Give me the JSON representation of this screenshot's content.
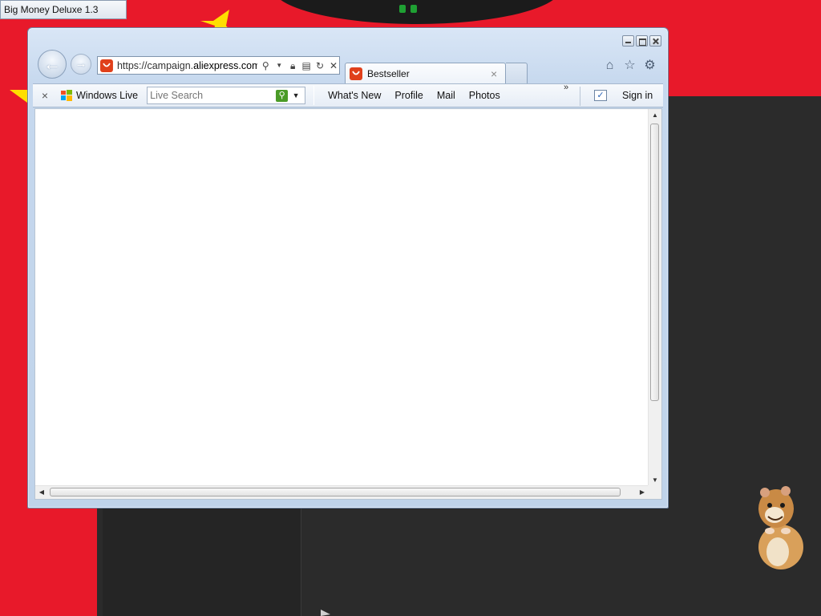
{
  "desktop": {
    "app_title": "Big Money Deluxe 1.3",
    "colors": {
      "flag_red": "#e8192a",
      "dark": "#2b2b2b",
      "star_yellow": "#ffde00"
    }
  },
  "browser": {
    "address_bar": {
      "url_prefix": "https://campaign.",
      "url_domain": "aliexpress.com",
      "icons": [
        "search-icon",
        "dropdown-icon",
        "lock-icon",
        "compat-icon",
        "refresh-icon",
        "stop-icon"
      ]
    },
    "tabs": [
      {
        "label": "Bestseller",
        "icon": "aliexpress-favicon",
        "active": true
      }
    ],
    "toolbar_icons": [
      "home-icon",
      "favorites-star-icon",
      "settings-gear-icon"
    ],
    "command_bar": {
      "brand": "Windows Live",
      "search_placeholder": "Live Search",
      "links": [
        "What's New",
        "Profile",
        "Mail",
        "Photos"
      ],
      "overflow": "»",
      "sign_in": "Sign in"
    }
  }
}
